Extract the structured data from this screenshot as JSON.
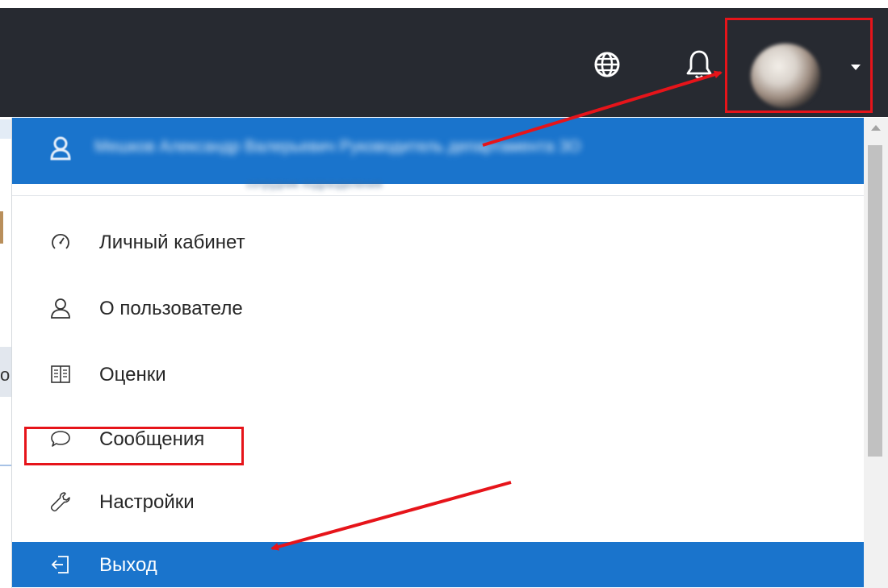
{
  "navbar": {
    "icons": [
      "globe-icon",
      "bell-icon"
    ],
    "background": "#272a31"
  },
  "user": {
    "name_line": "Мешков Александр Валерьевич Руководитель департамента ЗО",
    "sub_line": "сотрудник подразделения"
  },
  "menu": {
    "items": [
      {
        "label": "Личный кабинет",
        "icon": "dashboard-icon"
      },
      {
        "label": "О пользователе",
        "icon": "user-icon"
      },
      {
        "label": "Оценки",
        "icon": "grades-book-icon"
      },
      {
        "label": "Сообщения",
        "icon": "message-icon"
      },
      {
        "label": "Настройки",
        "icon": "wrench-icon"
      },
      {
        "label": "Выход",
        "icon": "logout-icon",
        "active": true
      }
    ]
  },
  "background_fragment": {
    "text": "о"
  },
  "colors": {
    "accent": "#1a74cc",
    "annotation": "#e6141a",
    "navbar": "#272a31"
  }
}
